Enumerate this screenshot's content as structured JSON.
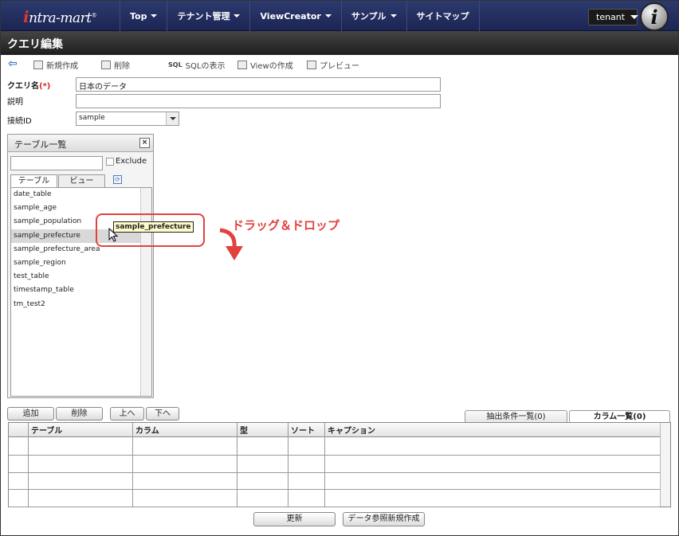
{
  "app": {
    "logo_prefix": "i",
    "logo_rest": "ntra-mart",
    "logo_mark": "®",
    "tenant": "tenant",
    "user_badge": "i"
  },
  "nav": [
    {
      "label": "Top",
      "dropdown": true
    },
    {
      "label": "テナント管理",
      "dropdown": true
    },
    {
      "label": "ViewCreator",
      "dropdown": true
    },
    {
      "label": "サンプル",
      "dropdown": true
    },
    {
      "label": "サイトマップ",
      "dropdown": false
    }
  ],
  "page_title": "クエリ編集",
  "toolbar": {
    "new": "新規作成",
    "delete": "削除",
    "sql_prefix": "SQL",
    "show_sql": "SQLの表示",
    "create_view": "Viewの作成",
    "preview": "プレビュー"
  },
  "form": {
    "query_name_label": "クエリ名",
    "required_mark": "(*)",
    "query_name_value": "日本のデータ",
    "description_label": "説明",
    "description_value": "",
    "connection_label": "接続ID",
    "connection_value": "sample"
  },
  "table_panel": {
    "title": "テーブル一覧",
    "close": "×",
    "filter_value": "",
    "exclude_label": "Exclude",
    "tab_table": "テーブル",
    "tab_view": "ビュー",
    "refresh": "⟳",
    "items": [
      "date_table",
      "sample_age",
      "sample_population",
      "sample_prefecture",
      "sample_prefecture_area",
      "sample_region",
      "test_table",
      "timestamp_table",
      "tm_test2"
    ],
    "selected_index": 3
  },
  "drag": {
    "tooltip": "sample_prefecture",
    "annotation": "ドラッグ＆ドロップ"
  },
  "grid_buttons": {
    "add": "追加",
    "delete": "削除",
    "up": "上へ",
    "down": "下へ"
  },
  "right_tabs": {
    "conditions": "抽出条件一覧(0)",
    "columns": "カラム一覧(0)"
  },
  "grid": {
    "headers": [
      "テーブル",
      "カラム",
      "型",
      "ソート",
      "キャプション"
    ],
    "rows": 4
  },
  "footer": {
    "update": "更新",
    "create_reference": "データ参照新規作成"
  },
  "colors": {
    "nav_bg": "#1c2554",
    "accent_red": "#e0433f"
  }
}
